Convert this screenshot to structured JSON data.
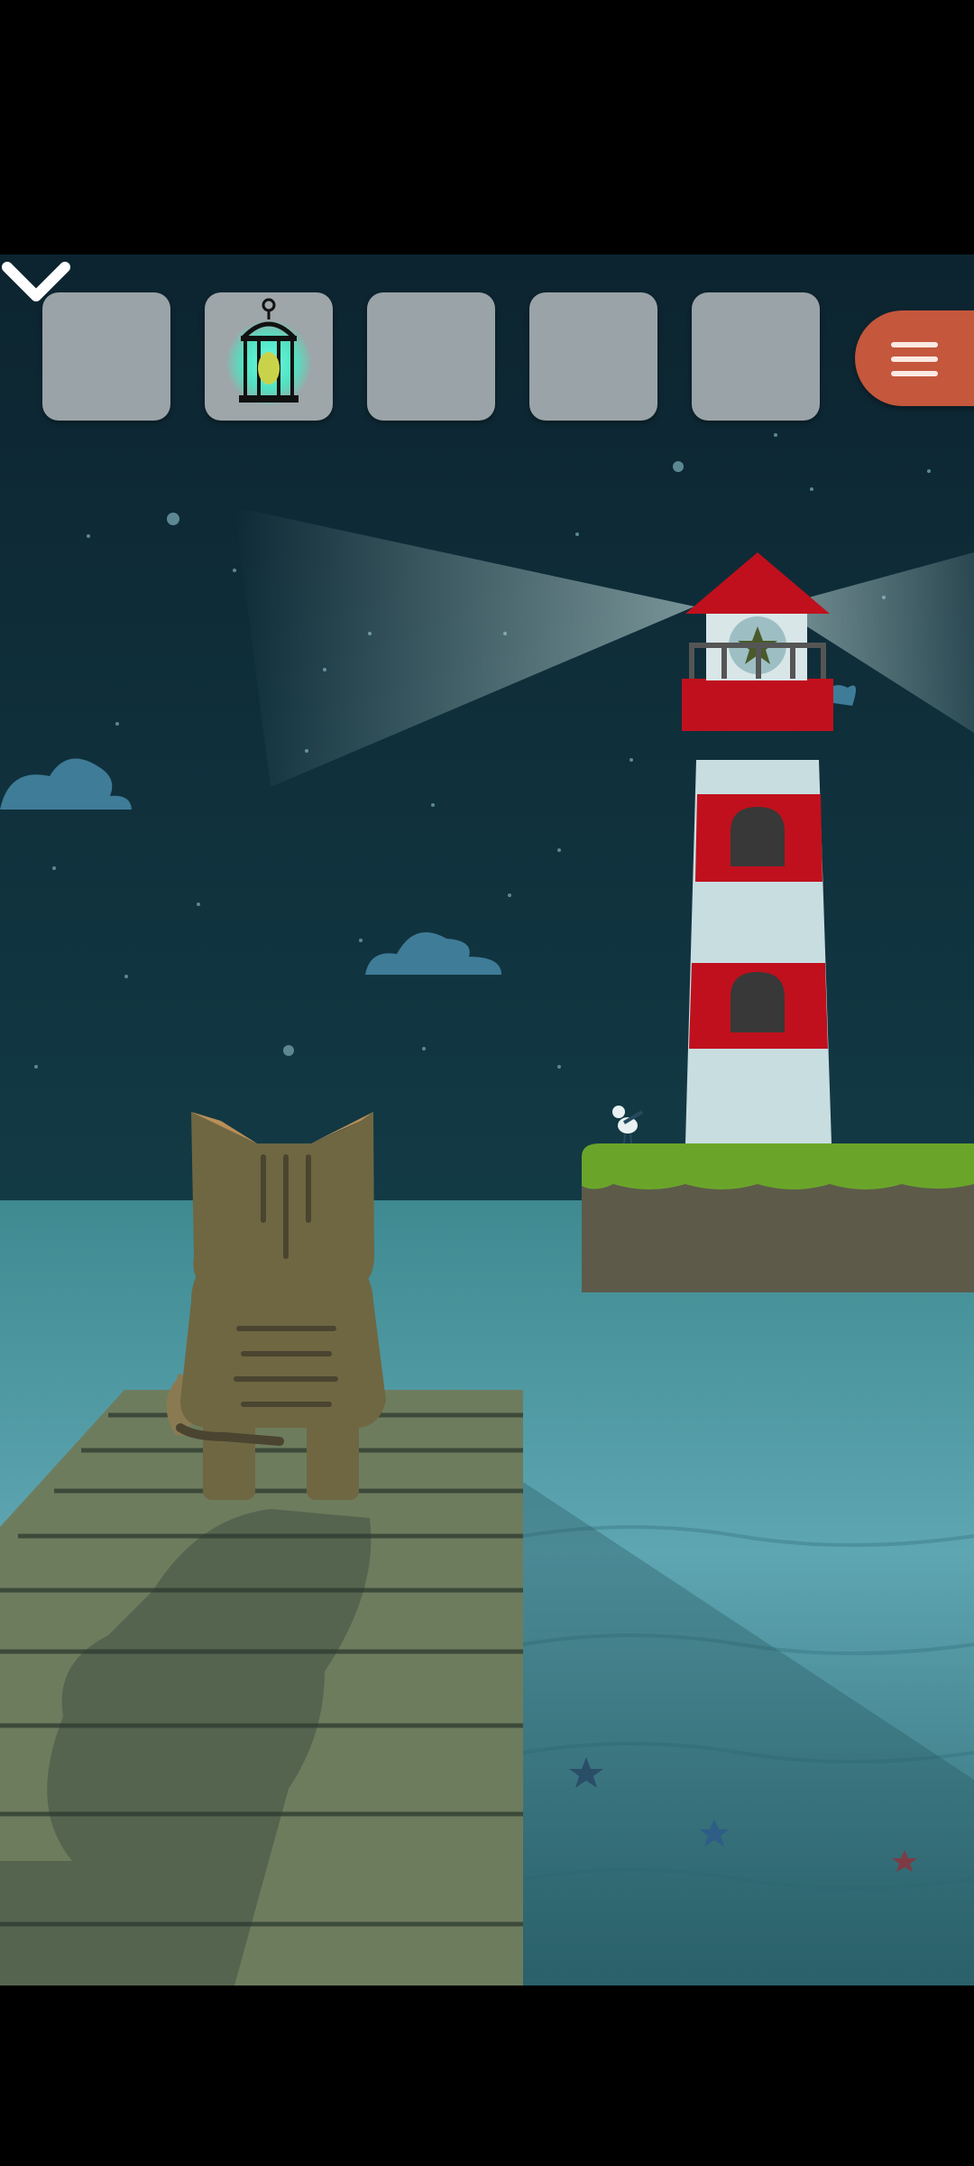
{
  "inventory": {
    "slots": [
      {
        "item": null
      },
      {
        "item": "lantern-icon",
        "selected": true
      },
      {
        "item": null
      },
      {
        "item": null
      },
      {
        "item": null
      }
    ]
  },
  "menu": {
    "icon": "hamburger-menu-icon"
  },
  "navigation": {
    "icon": "chevron-down-icon"
  },
  "scene": {
    "name": "lighthouse-pier-night",
    "colors": {
      "sky": "#0f2b37",
      "sea_top": "#3f8a91",
      "sea_bottom": "#2c5f6a",
      "lighthouse_red": "#c0101d",
      "lighthouse_white": "#c8dde0",
      "grass": "#6aa52a",
      "cliff": "#5d5a4a",
      "pier": "#6e7c5e",
      "cat": "#6f6742",
      "menu_button": "#c4573c",
      "slot": "#9aa3a7",
      "lantern_glow": "#4cffd9"
    }
  }
}
